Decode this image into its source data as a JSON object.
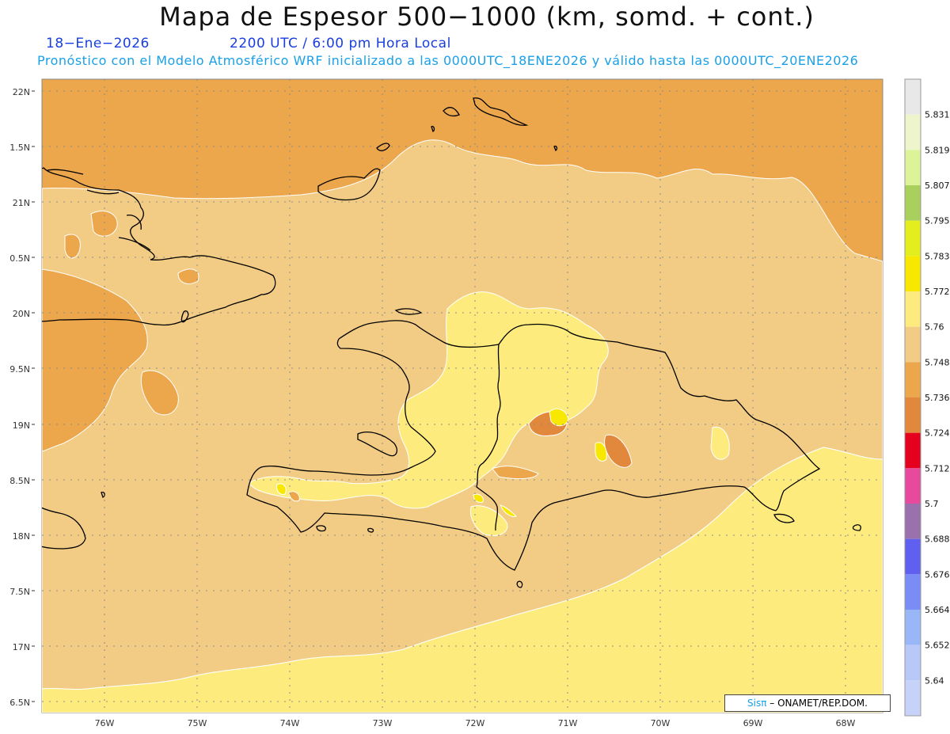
{
  "header": {
    "title": "Mapa de Espesor 500−1000 (km, somd. + cont.)",
    "date": "18−Ene−2026",
    "time": "2200 UTC / 6:00 pm Hora Local",
    "model_line": "Pronóstico con el Modelo Atmosférico WRF inicializado a las 0000UTC_18ENE2026 y válido hasta las  0000UTC_20ENE2026"
  },
  "axes": {
    "lat_labels": [
      "22N",
      "1.5N",
      "21N",
      "0.5N",
      "20N",
      "9.5N",
      "19N",
      "8.5N",
      "18N",
      "7.5N",
      "17N",
      "6.5N"
    ],
    "lon_labels": [
      "76W",
      "75W",
      "74W",
      "73W",
      "72W",
      "71W",
      "70W",
      "69W",
      "68W"
    ]
  },
  "legend": {
    "levels": [
      "5.831",
      "5.819",
      "5.807",
      "5.795",
      "5.783",
      "5.772",
      "5.76",
      "5.748",
      "5.736",
      "5.724",
      "5.712",
      "5.7",
      "5.688",
      "5.676",
      "5.664",
      "5.652",
      "5.64"
    ],
    "colors": [
      "#e8e8e8",
      "#eef4cc",
      "#ddf39a",
      "#a9cf5c",
      "#e4ee1e",
      "#f8e800",
      "#fdec7d",
      "#f2cc84",
      "#eca64b",
      "#e2883c",
      "#e5001e",
      "#e74a9c",
      "#9a71ad",
      "#5f5ff0",
      "#7a8cf6",
      "#99b7f6",
      "#b9c9f7"
    ]
  },
  "credit": {
    "sis": "Sis",
    "pi": "π",
    "org": "– ONAMET/REP.DOM."
  },
  "fields": {
    "north_color": "#eca64b",
    "mid_color": "#f2cc84",
    "south_color": "#fdec7d",
    "high_color": "#f8e800",
    "low_color": "#e2883c",
    "coast_color": "#000000",
    "grid_color": "#8a8a8a"
  }
}
